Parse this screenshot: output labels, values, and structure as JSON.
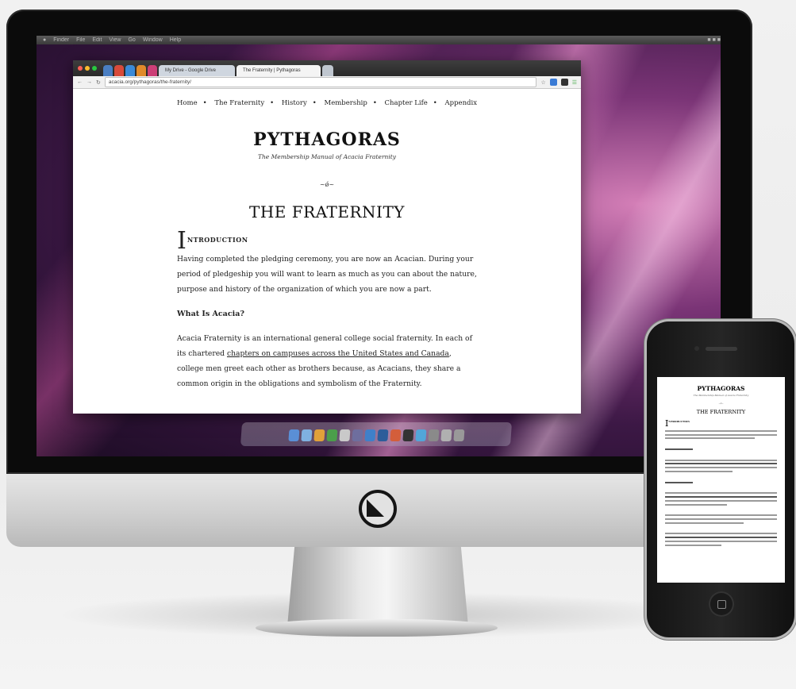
{
  "os": {
    "menubar": [
      "",
      "Finder",
      "File",
      "Edit",
      "View",
      "Go",
      "Window",
      "Help"
    ]
  },
  "browser": {
    "tabs": [
      "My Drive - Google Drive",
      "The Fraternity | Pythagoras"
    ],
    "url": "acacia.org/pythagoras/the-fraternity/"
  },
  "site": {
    "nav": [
      "Home",
      "The Fraternity",
      "History",
      "Membership",
      "Chapter Life",
      "Appendix"
    ],
    "title": "PYTHAGORAS",
    "subtitle": "The Membership Manual of Acacia Fraternity",
    "ornament": "~ǿ~",
    "page_heading": "THE FRATERNITY"
  },
  "article": {
    "dropcap": "I",
    "intro_label": "NTRODUCTION",
    "intro_para": "Having completed the pledging ceremony, you are now an Acacian. During your period of pledgeship you will want to learn as much as you can about the nature, purpose and history of the organization of which you are now a part.",
    "subhead": "What Is Acacia?",
    "p2_before": "Acacia Fraternity is an international general college social fraternity. In each of its chartered",
    "p2_link": "chapters on campuses across the United States and Canada",
    "p2_after": ", college men greet each other as brothers because, as Acacians, they share a common origin in the obligations and symbolism of the Fraternity."
  },
  "mobile": {
    "title": "PYTHAGORAS",
    "subtitle": "The Membership Manual of Acacia Fraternity",
    "heading": "THE FRATERNITY",
    "dropcap": "I",
    "intro_label": "NTRODUCTION"
  },
  "colors": {
    "traffic_red": "#ff5f57",
    "traffic_yellow": "#febc2e",
    "traffic_green": "#28c840"
  }
}
